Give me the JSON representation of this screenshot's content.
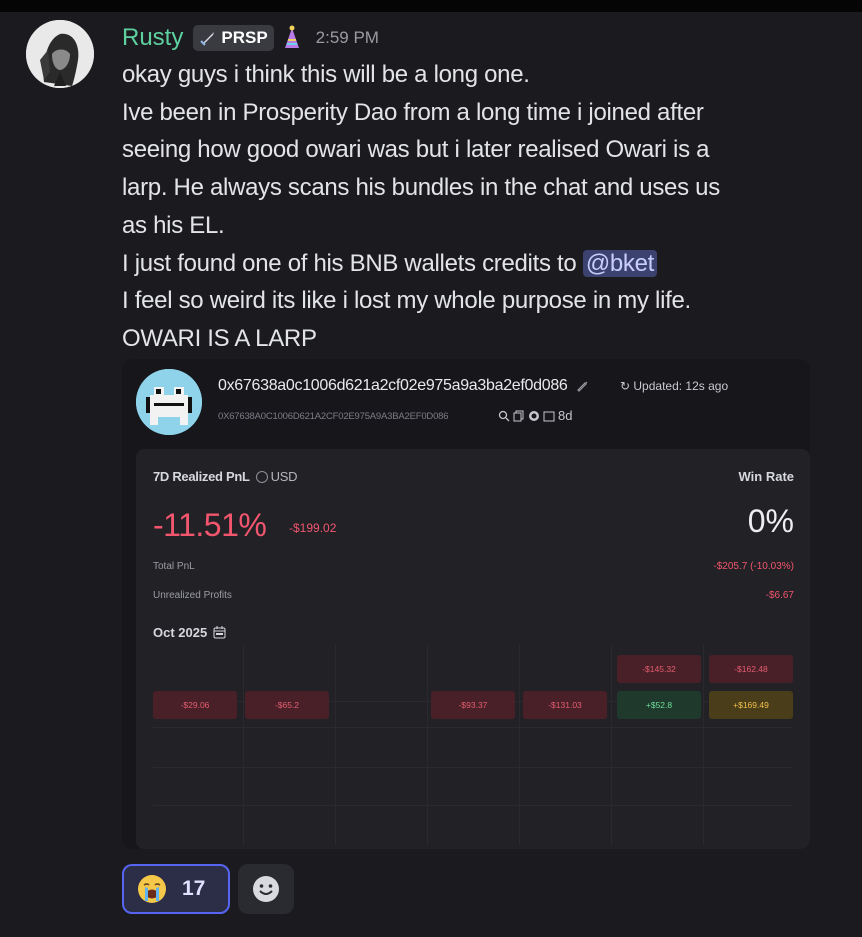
{
  "message": {
    "author": "Rusty",
    "tag": "PRSP",
    "timestamp": "2:59 PM",
    "lines": [
      "okay guys i think this will be a long one.",
      "Ive been in Prosperity Dao from a long time i joined after",
      "seeing how good owari was but i later realised Owari is a",
      "larp. He always scans his bundles in the chat and uses us",
      "as his EL.",
      "I just found one of his BNB wallets credits to ",
      "I feel so weird its like i lost my whole purpose in my life.",
      "OWARI IS A LARP"
    ],
    "mention": "@bket"
  },
  "embed": {
    "address": "0x67638a0c1006d621a2cf02e975a9a3ba2ef0d086",
    "updated": "Updated: 12s ago",
    "address_upper": "0X67638A0C1006D621A2CF02E975A9A3BA2EF0D086",
    "age": "8d",
    "pnl_label": "7D Realized PnL",
    "currency": "USD",
    "winrate_label": "Win Rate",
    "pnl_percent": "-11.51%",
    "pnl_usd": "-$199.02",
    "winrate": "0%",
    "total_pnl_label": "Total PnL",
    "total_pnl_value": "-$205.7 (-10.03%)",
    "unrealized_label": "Unrealized Profits",
    "unrealized_value": "-$6.67",
    "month": "Oct 2025",
    "calendar_cells": [
      "-$145.32",
      "-$162.48",
      "-$29.06",
      "-$65.2",
      "-$93.37",
      "-$131.03",
      "+$52.8",
      "+$169.49"
    ]
  },
  "reactions": [
    {
      "icon": "crying-face-icon",
      "count": "17"
    }
  ],
  "colors": {
    "background": "#1b1b1f",
    "username": "#5ed0a0",
    "mention_bg": "#3c4270",
    "negative": "#f2566e",
    "positive": "#6fdd9a",
    "reaction_border": "#5865f2"
  }
}
